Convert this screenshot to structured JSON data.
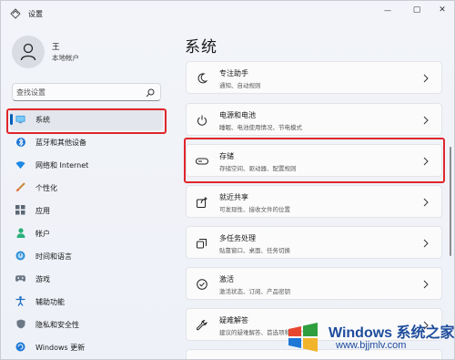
{
  "window": {
    "title": "设置",
    "controls": {
      "minimize": "—",
      "maximize": "▢",
      "close": "✕"
    }
  },
  "user": {
    "name": "王",
    "account": "本地帐户"
  },
  "search": {
    "placeholder": "查找设置"
  },
  "nav": {
    "items": [
      {
        "label": "系统",
        "icon": "monitor-icon",
        "active": true
      },
      {
        "label": "蓝牙和其他设备",
        "icon": "bluetooth-icon"
      },
      {
        "label": "网络和 Internet",
        "icon": "wifi-icon"
      },
      {
        "label": "个性化",
        "icon": "brush-icon"
      },
      {
        "label": "应用",
        "icon": "apps-icon"
      },
      {
        "label": "帐户",
        "icon": "person-icon"
      },
      {
        "label": "时间和语言",
        "icon": "globe-clock-icon"
      },
      {
        "label": "游戏",
        "icon": "gamepad-icon"
      },
      {
        "label": "辅助功能",
        "icon": "accessibility-icon"
      },
      {
        "label": "隐私和安全性",
        "icon": "shield-icon"
      },
      {
        "label": "Windows 更新",
        "icon": "update-icon"
      }
    ]
  },
  "main": {
    "title": "系统",
    "cards": [
      {
        "title": "专注助手",
        "subtitle": "通知、自动规则",
        "icon": "moon-icon"
      },
      {
        "title": "电源和电池",
        "subtitle": "睡眠、电池使用情况、节电模式",
        "icon": "power-icon"
      },
      {
        "title": "存储",
        "subtitle": "存储空间、驱动器、配置规则",
        "icon": "storage-icon"
      },
      {
        "title": "就近共享",
        "subtitle": "可发现性、接收文件的位置",
        "icon": "share-icon"
      },
      {
        "title": "多任务处理",
        "subtitle": "贴靠窗口、桌面、任务切换",
        "icon": "multitask-icon"
      },
      {
        "title": "激活",
        "subtitle": "激活状态、订阅、产品密钥",
        "icon": "check-circle-icon"
      },
      {
        "title": "疑难解答",
        "subtitle": "建议的疑难解答、首选项和历史记录",
        "icon": "wrench-icon"
      }
    ]
  },
  "watermark": {
    "line1": "Windows",
    "line1_cn": "系统之家",
    "line2": "www.bjjmlv.com"
  },
  "colors": {
    "accent": "#005fb8",
    "highlight": "#e0262b",
    "watermark": "#1f4c9c"
  }
}
